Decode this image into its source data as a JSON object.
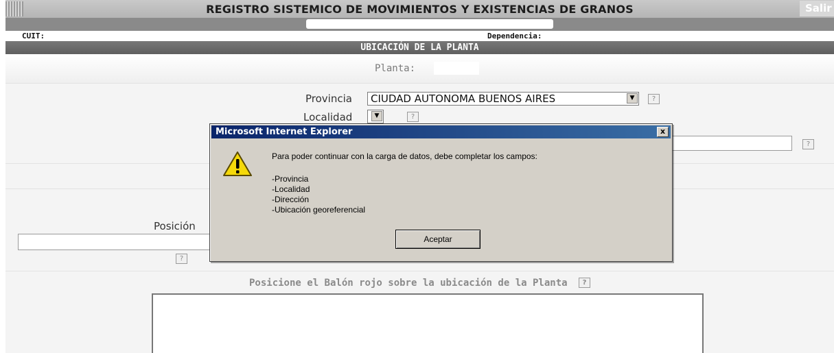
{
  "header": {
    "title": "REGISTRO SISTEMICO DE MOVIMIENTOS Y EXISTENCIAS DE GRANOS",
    "exit_label": "Salir"
  },
  "info": {
    "cuit_label": "CUIT:",
    "dependencia_label": "Dependencia:"
  },
  "section": {
    "title": "UBICACIÓN DE LA PLANTA"
  },
  "form": {
    "planta_label": "Planta:",
    "provincia_label": "Provincia",
    "provincia_value": "CIUDAD AUTONOMA BUENOS AIRES",
    "localidad_label": "Localidad",
    "posicion_label": "Posición",
    "help_label": "?"
  },
  "map": {
    "title": "Posicione el Balón rojo sobre la ubicación de la Planta"
  },
  "dialog": {
    "title": "Microsoft Internet Explorer",
    "close_label": "x",
    "message": "Para poder continuar con la carga de datos, debe completar los campos:",
    "fields": [
      "-Provincia",
      "-Localidad",
      "-Dirección",
      "-Ubicación georeferencial"
    ],
    "ok_label": "Aceptar",
    "icon": "warning-icon"
  }
}
